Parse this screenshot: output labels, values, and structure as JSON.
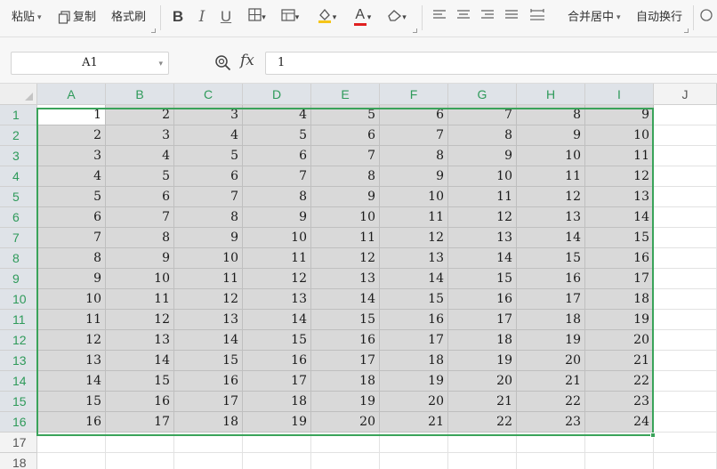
{
  "ribbon": {
    "paste_label": "粘贴",
    "copy_label": "复制",
    "format_painter_label": "格式刷",
    "bold": "B",
    "italic": "I",
    "underline": "U",
    "font_color_glyph": "A",
    "merge_center_label": "合并居中",
    "wrap_text_label": "自动换行",
    "accent_color": "#3aa35a",
    "font_color_bar": "#e02020",
    "fill_color_bar": "#f5c518"
  },
  "formula_bar": {
    "name_box": "A1",
    "fx_label": "fx",
    "formula_value": "1"
  },
  "sheet": {
    "columns": [
      "A",
      "B",
      "C",
      "D",
      "E",
      "F",
      "G",
      "H",
      "I",
      "J"
    ],
    "selected_columns": 9,
    "rows": [
      "1",
      "2",
      "3",
      "4",
      "5",
      "6",
      "7",
      "8",
      "9",
      "10",
      "11",
      "12",
      "13",
      "14",
      "15",
      "16",
      "17",
      "18"
    ],
    "selected_rows": 16,
    "active_cell": "A1",
    "values": [
      [
        "1",
        "2",
        "3",
        "4",
        "5",
        "6",
        "7",
        "8",
        "9"
      ],
      [
        "2",
        "3",
        "4",
        "5",
        "6",
        "7",
        "8",
        "9",
        "10"
      ],
      [
        "3",
        "4",
        "5",
        "6",
        "7",
        "8",
        "9",
        "10",
        "11"
      ],
      [
        "4",
        "5",
        "6",
        "7",
        "8",
        "9",
        "10",
        "11",
        "12"
      ],
      [
        "5",
        "6",
        "7",
        "8",
        "9",
        "10",
        "11",
        "12",
        "13"
      ],
      [
        "6",
        "7",
        "8",
        "9",
        "10",
        "11",
        "12",
        "13",
        "14"
      ],
      [
        "7",
        "8",
        "9",
        "10",
        "11",
        "12",
        "13",
        "14",
        "15"
      ],
      [
        "8",
        "9",
        "10",
        "11",
        "12",
        "13",
        "14",
        "15",
        "16"
      ],
      [
        "9",
        "10",
        "11",
        "12",
        "13",
        "14",
        "15",
        "16",
        "17"
      ],
      [
        "10",
        "11",
        "12",
        "13",
        "14",
        "15",
        "16",
        "17",
        "18"
      ],
      [
        "11",
        "12",
        "13",
        "14",
        "15",
        "16",
        "17",
        "18",
        "19"
      ],
      [
        "12",
        "13",
        "14",
        "15",
        "16",
        "17",
        "18",
        "19",
        "20"
      ],
      [
        "13",
        "14",
        "15",
        "16",
        "17",
        "18",
        "19",
        "20",
        "21"
      ],
      [
        "14",
        "15",
        "16",
        "17",
        "18",
        "19",
        "20",
        "21",
        "22"
      ],
      [
        "15",
        "16",
        "17",
        "18",
        "19",
        "20",
        "21",
        "22",
        "23"
      ],
      [
        "16",
        "17",
        "18",
        "19",
        "20",
        "21",
        "22",
        "23",
        "24"
      ]
    ]
  }
}
